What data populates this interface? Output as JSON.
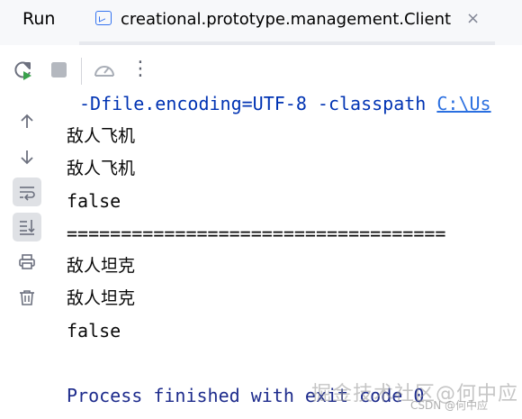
{
  "header": {
    "run_label": "Run",
    "tab_label": "creational.prototype.management.Client",
    "tab_close": "×"
  },
  "toolbar": {
    "rerun_icon": "rerun-icon",
    "stop_icon": "stop-icon",
    "profiler_icon": "gauge-icon",
    "more_icon": "more-vertical-icon",
    "more_glyph": "⋮"
  },
  "gutter": {
    "buttons": [
      "arrow-up-icon",
      "arrow-down-icon",
      "soft-wrap-icon",
      "scroll-to-end-icon",
      "print-icon",
      "trash-icon"
    ]
  },
  "console": {
    "command_prefix": "-Dfile.encoding=UTF-8 -classpath ",
    "command_link": "C:\\Us",
    "lines": [
      "敌人飞机",
      "敌人飞机",
      "false",
      "===================================",
      "敌人坦克",
      "敌人坦克",
      "false",
      "",
      "Process finished with exit code 0"
    ]
  },
  "watermark": {
    "main": "掘金技术社区@何中应",
    "sub": "CSDN @何中应"
  },
  "colors": {
    "accent": "#3574f0",
    "console_text": "#080808",
    "process_text": "#1d2b8c",
    "link": "#2a6fe0",
    "active_button_bg": "#dfe1e5"
  }
}
